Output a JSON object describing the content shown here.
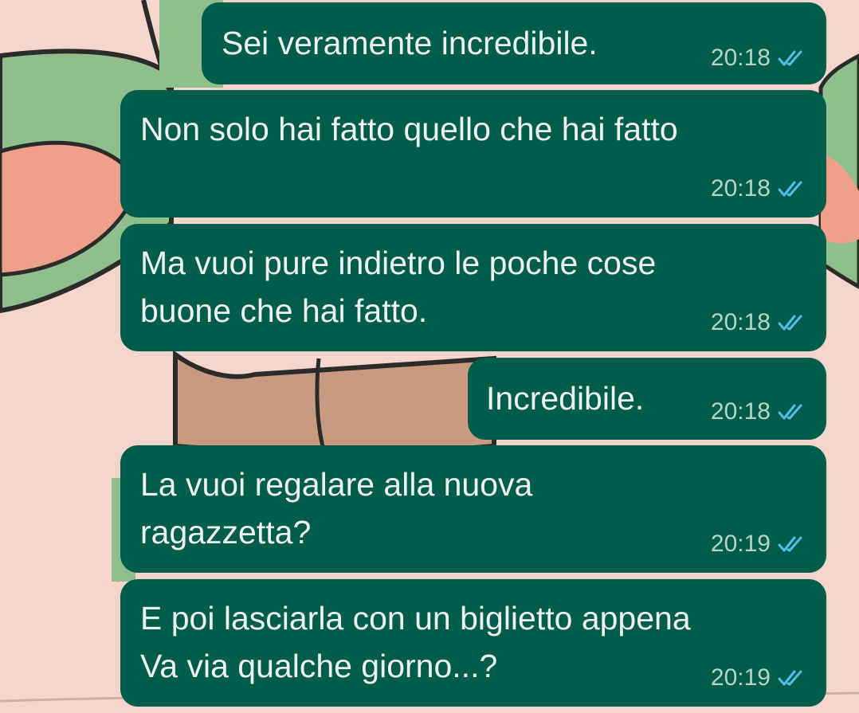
{
  "chat": {
    "messages": [
      {
        "lines": [
          "Sei veramente incredibile."
        ],
        "time": "20:18",
        "status": "read"
      },
      {
        "lines": [
          "Non solo hai fatto quello che hai fatto"
        ],
        "time": "20:18",
        "status": "read"
      },
      {
        "lines": [
          "Ma vuoi pure indietro le poche cose",
          "buone che hai fatto."
        ],
        "time": "20:18",
        "status": "read"
      },
      {
        "lines": [
          "Incredibile."
        ],
        "time": "20:18",
        "status": "read"
      },
      {
        "lines": [
          "La vuoi regalare alla nuova",
          "ragazzetta?"
        ],
        "time": "20:19",
        "status": "read"
      },
      {
        "lines": [
          "E poi lasciarla con un biglietto appena",
          "Va via qualche giorno...?"
        ],
        "time": "20:19",
        "status": "read"
      }
    ]
  },
  "theme": {
    "bubble_color": "#005c4b",
    "read_tick_color": "#53bdeb",
    "wallpaper_bg": "#f6d6cc",
    "wallpaper_green": "#8fbf8a",
    "wallpaper_salmon": "#f0a08a",
    "wallpaper_brown": "#c99a80"
  },
  "icons": {
    "read_receipt": "double-check-icon"
  }
}
